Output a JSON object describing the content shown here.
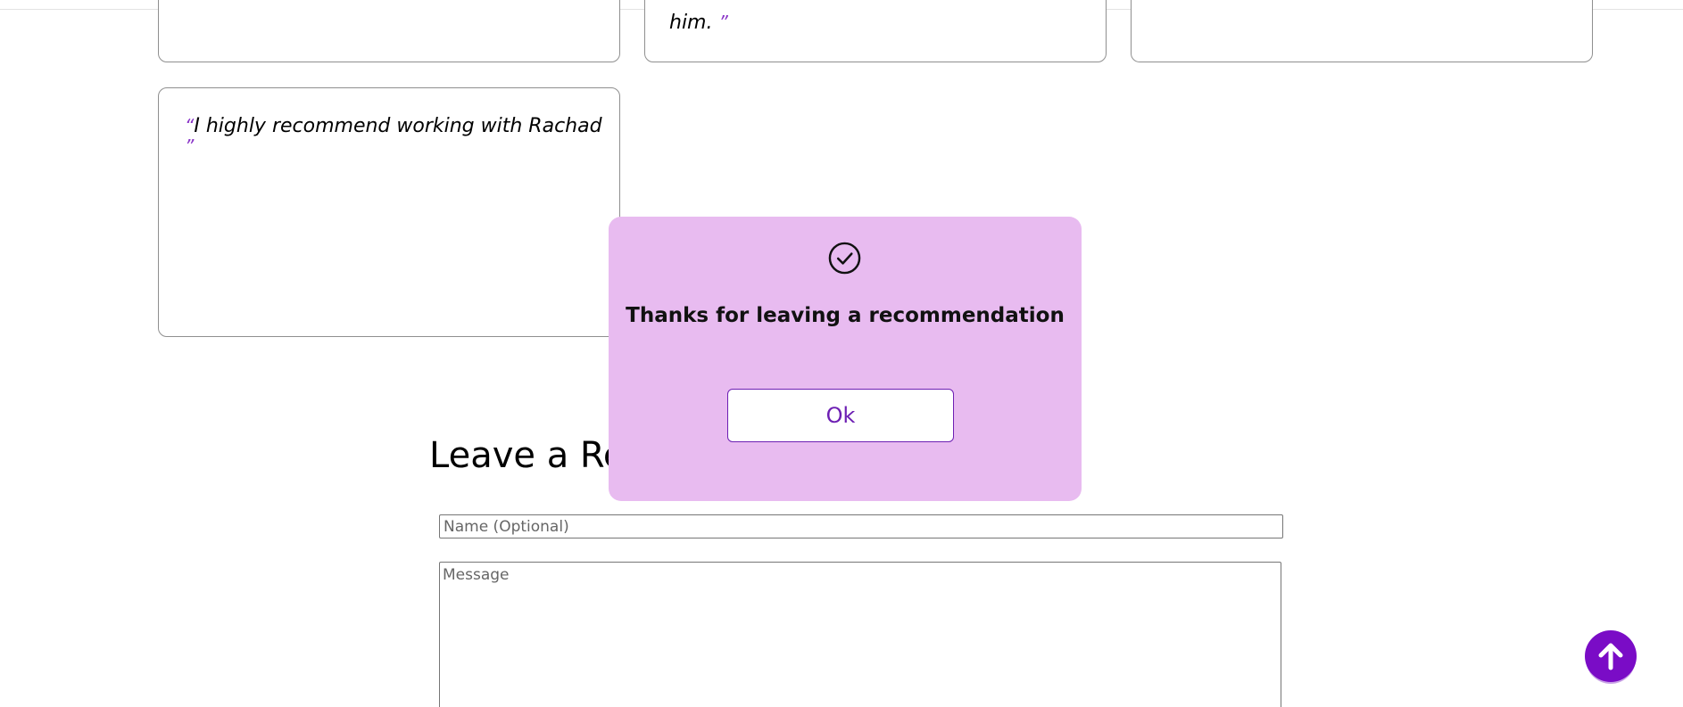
{
  "testimonials": {
    "card2_tail": "him.",
    "card4_text": "I highly recommend working with Rachad",
    "open_quote": "“",
    "close_quote": "”"
  },
  "form": {
    "heading": "Leave a Rec",
    "name_placeholder": "Name (Optional)",
    "message_placeholder": "Message"
  },
  "modal": {
    "icon": "check-circle-icon",
    "text": "Thanks for leaving a recommendation",
    "ok_label": "Ok"
  },
  "scroll_top": {
    "icon": "arrow-up-icon"
  },
  "colors": {
    "accent": "#7a0cc6",
    "modal_bg": "#e8bbf0",
    "quote_mark": "#8a35c8"
  }
}
